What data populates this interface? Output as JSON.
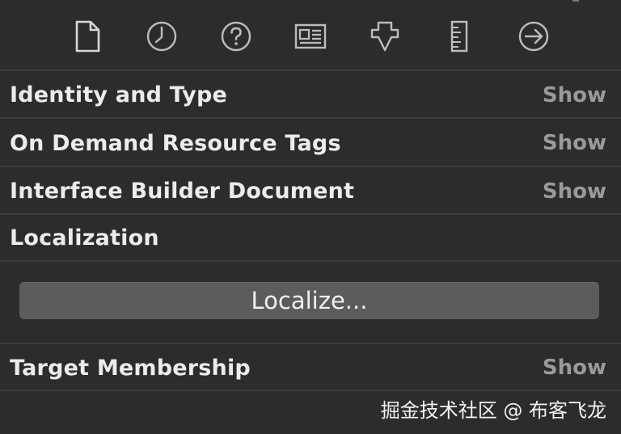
{
  "toolbar": {
    "icons": [
      "file-inspector-icon",
      "history-inspector-icon",
      "quick-help-icon",
      "identity-inspector-icon",
      "attributes-inspector-icon",
      "size-inspector-icon",
      "connections-inspector-icon"
    ]
  },
  "sections": [
    {
      "title": "Identity and Type",
      "action": "Show"
    },
    {
      "title": "On Demand Resource Tags",
      "action": "Show"
    },
    {
      "title": "Interface Builder Document",
      "action": "Show"
    },
    {
      "title": "Localization",
      "action": ""
    },
    {
      "title": "Target Membership",
      "action": "Show"
    }
  ],
  "localization": {
    "button_label": "Localize..."
  },
  "watermark": "掘金技术社区 @ 布客飞龙",
  "colors": {
    "background": "#2c2c2c",
    "divider": "#3d3d3d",
    "title_text": "#ececec",
    "show_text": "#9a9a9a",
    "button_bg": "#5c5c5c",
    "icon_stroke": "#bdbdbd",
    "icon_active": "#d8d8d8"
  }
}
